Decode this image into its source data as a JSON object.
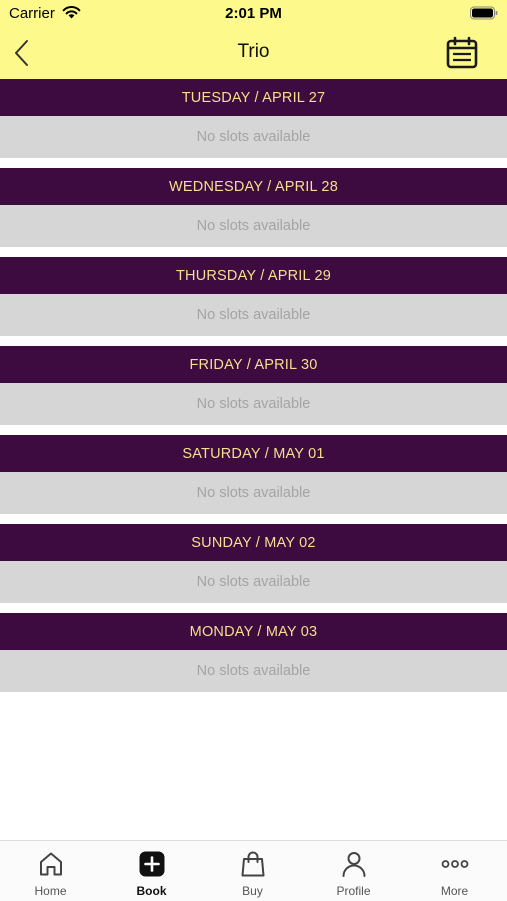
{
  "status_bar": {
    "carrier": "Carrier",
    "time": "2:01 PM"
  },
  "header": {
    "title": "Trio",
    "back_icon": "chevron-left-icon",
    "calendar_icon": "calendar-icon"
  },
  "colors": {
    "header_bg": "#fdf98a",
    "day_header_bg": "#3d0b3f",
    "day_header_text": "#f6df8e",
    "slot_bg": "#d6d6d6"
  },
  "days": [
    {
      "label": "TUESDAY / APRIL 27",
      "slots_text": "No slots available"
    },
    {
      "label": "WEDNESDAY / APRIL 28",
      "slots_text": "No slots available"
    },
    {
      "label": "THURSDAY / APRIL 29",
      "slots_text": "No slots available"
    },
    {
      "label": "FRIDAY / APRIL 30",
      "slots_text": "No slots available"
    },
    {
      "label": "SATURDAY / MAY 01",
      "slots_text": "No slots available"
    },
    {
      "label": "SUNDAY / MAY 02",
      "slots_text": "No slots available"
    },
    {
      "label": "MONDAY / MAY 03",
      "slots_text": "No slots available"
    }
  ],
  "tab_bar": {
    "items": [
      {
        "label": "Home",
        "icon": "home-icon",
        "active": false
      },
      {
        "label": "Book",
        "icon": "plus-square-icon",
        "active": true
      },
      {
        "label": "Buy",
        "icon": "shopping-bag-icon",
        "active": false
      },
      {
        "label": "Profile",
        "icon": "person-icon",
        "active": false
      },
      {
        "label": "More",
        "icon": "more-dots-icon",
        "active": false
      }
    ]
  }
}
